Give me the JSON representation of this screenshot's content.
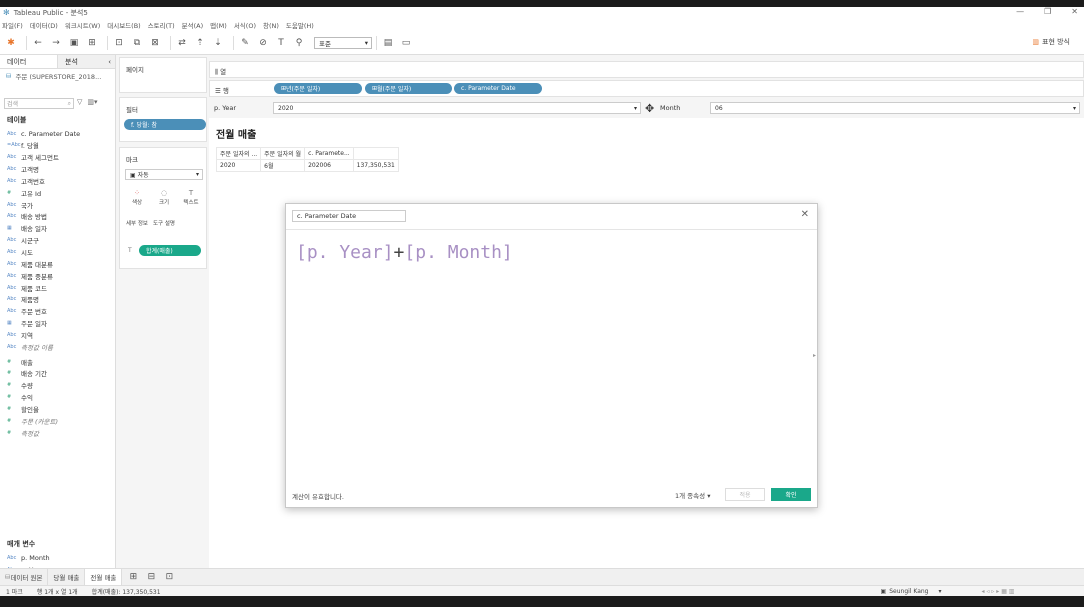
{
  "app": {
    "title": "Tableau Public - 분석5",
    "window_controls": [
      "—",
      "❐",
      "✕"
    ]
  },
  "menu": [
    "파일(F)",
    "데이터(D)",
    "워크시트(W)",
    "대시보드(B)",
    "스토리(T)",
    "분석(A)",
    "맵(M)",
    "서식(O)",
    "창(N)",
    "도움말(H)"
  ],
  "toolbar": {
    "fit_select": "표준",
    "show_me": "표현 방식"
  },
  "left_pane": {
    "tab_data": "데이터",
    "tab_analysis": "분석",
    "datasource": "주문 (SUPERSTORE_2018...",
    "search_placeholder": "검색",
    "tables_header": "테이블",
    "dimensions": [
      {
        "type": "Abc",
        "label": "c. Parameter Date"
      },
      {
        "type": "=Abc",
        "label": "f. 당월"
      },
      {
        "type": "Abc",
        "label": "고객 세그먼트"
      },
      {
        "type": "Abc",
        "label": "고객명"
      },
      {
        "type": "Abc",
        "label": "고객번호"
      },
      {
        "type": "#",
        "label": "고유 Id"
      },
      {
        "type": "Abc",
        "label": "국가"
      },
      {
        "type": "Abc",
        "label": "배송 방법"
      },
      {
        "type": "date",
        "label": "배송 일자"
      },
      {
        "type": "Abc",
        "label": "시군구"
      },
      {
        "type": "Abc",
        "label": "시도"
      },
      {
        "type": "Abc",
        "label": "제품 대분류"
      },
      {
        "type": "Abc",
        "label": "제품 중분류"
      },
      {
        "type": "Abc",
        "label": "제품 코드"
      },
      {
        "type": "Abc",
        "label": "제품명"
      },
      {
        "type": "Abc",
        "label": "주문 번호"
      },
      {
        "type": "date",
        "label": "주문 일자"
      },
      {
        "type": "Abc",
        "label": "지역"
      },
      {
        "type": "Abc",
        "label": "측정값 이름"
      }
    ],
    "measures": [
      {
        "type": "#",
        "label": "매출"
      },
      {
        "type": "#",
        "label": "배송 기간"
      },
      {
        "type": "#",
        "label": "수량"
      },
      {
        "type": "#",
        "label": "수익"
      },
      {
        "type": "#",
        "label": "할인율"
      },
      {
        "type": "#",
        "label": "주문 (카운트)"
      },
      {
        "type": "#",
        "label": "측정값"
      }
    ],
    "params_header": "매개 변수",
    "params": [
      {
        "type": "Abc",
        "label": "p. Month"
      },
      {
        "type": "Abc",
        "label": "p. Year"
      }
    ]
  },
  "shelves": {
    "pages_label": "페이지",
    "filters_label": "필터",
    "filter_pill": "f. 당월: 참",
    "marks_label": "마크",
    "marks_type": "자동",
    "mark_buttons": [
      "색상",
      "크기",
      "텍스트",
      "세부 정보",
      "도구 설명"
    ],
    "marks_pill": "합계(매출)",
    "columns_label": "열",
    "rows_label": "행",
    "row_pills": [
      "년(주문 일자)",
      "월(주문 일자)",
      "c. Parameter Date"
    ]
  },
  "params_bar": {
    "year_label": "p. Year",
    "year_value": "2020",
    "month_label": "Month",
    "month_value": "06"
  },
  "sheet": {
    "title": "전월 매출",
    "headers": [
      "주문 일자의 ...",
      "주문 일자의 월",
      "c. Paramete..."
    ],
    "row": [
      "2020",
      "6월",
      "202006",
      "137,350,531"
    ]
  },
  "dialog": {
    "calc_name": "c. Parameter Date",
    "formula_a": "[p. Year]",
    "formula_op": "+",
    "formula_b": "[p. Month]",
    "status": "계산이 유효합니다.",
    "dependencies": "1개 종속성 ▾",
    "apply": "적용",
    "ok": "확인"
  },
  "sheet_tabs": {
    "datasource": "데이터 원본",
    "tabs": [
      "당월 매출",
      "전월 매출"
    ]
  },
  "status_bar": {
    "marks": "1 마크",
    "rows_cols": "행 1개 x 열 1개",
    "sum": "합계(매출): 137,350,531",
    "user": "Seungil Kang"
  },
  "colors": {
    "pill_blue": "#4b8fb8",
    "pill_green": "#1aa88a",
    "formula": "#a890c4"
  }
}
